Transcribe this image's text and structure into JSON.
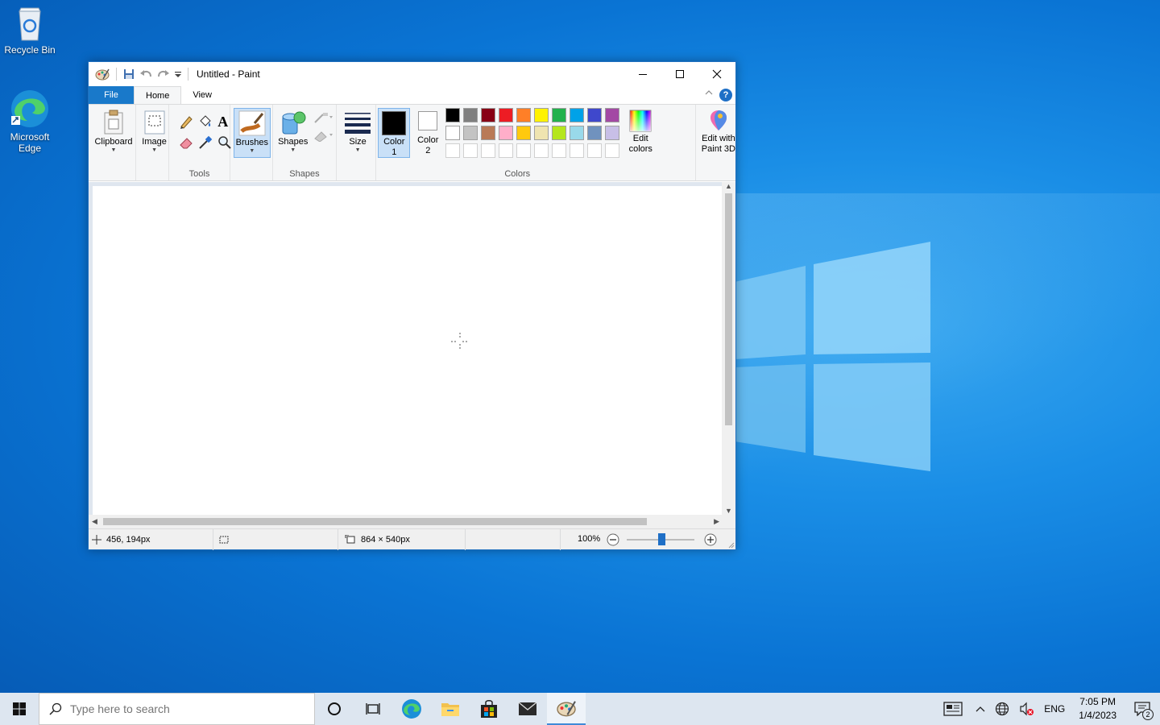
{
  "desktop": {
    "icons": [
      {
        "label": "Recycle Bin",
        "icon": "recycle-bin-icon"
      },
      {
        "label": "Microsoft Edge",
        "icon": "edge-icon"
      }
    ]
  },
  "window": {
    "title": "Untitled - Paint",
    "tabs": [
      {
        "label": "File"
      },
      {
        "label": "Home"
      },
      {
        "label": "View"
      }
    ],
    "help_label": "?"
  },
  "ribbon": {
    "clipboard": {
      "label": "Clipboard"
    },
    "image": {
      "label": "Image"
    },
    "tools": {
      "label": "Tools",
      "text_tool": "A"
    },
    "brushes": {
      "label": "Brushes"
    },
    "shapes": {
      "label": "Shapes",
      "group_label": "Shapes"
    },
    "size": {
      "label": "Size"
    },
    "color1": {
      "label_line1": "Color",
      "label_line2": "1",
      "value": "#000000"
    },
    "color2": {
      "label_line1": "Color",
      "label_line2": "2",
      "value": "#ffffff"
    },
    "colors_group_label": "Colors",
    "palette": [
      "#000000",
      "#7f7f7f",
      "#880015",
      "#ed1c24",
      "#ff7f27",
      "#fff200",
      "#22b14c",
      "#00a2e8",
      "#3f48cc",
      "#a349a4",
      "#ffffff",
      "#c3c3c3",
      "#b97a57",
      "#ffaec9",
      "#ffc90e",
      "#efe4b0",
      "#b5e61d",
      "#99d9ea",
      "#7092be",
      "#c8bfe7",
      "#ffffff",
      "#ffffff",
      "#ffffff",
      "#ffffff",
      "#ffffff",
      "#ffffff",
      "#ffffff",
      "#ffffff",
      "#ffffff",
      "#ffffff"
    ],
    "edit_colors": {
      "line1": "Edit",
      "line2": "colors"
    },
    "paint3d": {
      "line1": "Edit with",
      "line2": "Paint 3D"
    }
  },
  "status": {
    "cursor_position": "456, 194px",
    "canvas_size": "864 × 540px",
    "zoom": "100%",
    "zoom_fraction": 0.5
  },
  "taskbar": {
    "search_placeholder": "Type here to search",
    "language": "ENG",
    "time": "7:05 PM",
    "date": "1/4/2023",
    "notification_count": "2"
  },
  "colors": {
    "accent": "#1979ca",
    "taskbar": "#dde6f0"
  }
}
